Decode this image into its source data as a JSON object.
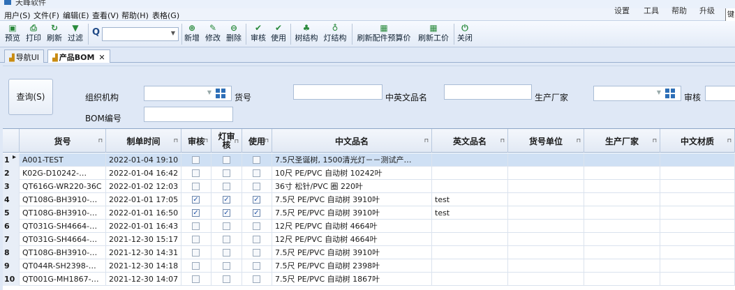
{
  "app": {
    "title": "天峰软件"
  },
  "menu": {
    "items": [
      "用户(S)",
      "文件(F)",
      "编辑(E)",
      "查看(V)",
      "帮助(H)",
      "表格(G)"
    ],
    "right_items": [
      "设置",
      "工具",
      "帮助",
      "升级"
    ],
    "keyboard_tab": "键"
  },
  "toolbar": {
    "buttons": [
      {
        "label": "预览",
        "icon": "preview-icon",
        "glyph": "▣"
      },
      {
        "label": "打印",
        "icon": "print-icon",
        "glyph": "⎙"
      },
      {
        "label": "刷新",
        "icon": "refresh-icon",
        "glyph": "↻"
      },
      {
        "label": "过滤",
        "icon": "filter-icon",
        "glyph": "▼"
      },
      {
        "label": "新增",
        "icon": "add-icon",
        "glyph": "⊕"
      },
      {
        "label": "修改",
        "icon": "edit-icon",
        "glyph": "✎"
      },
      {
        "label": "删除",
        "icon": "delete-icon",
        "glyph": "⊖"
      },
      {
        "label": "审核",
        "icon": "check-icon",
        "glyph": "✔"
      },
      {
        "label": "使用",
        "icon": "use-icon",
        "glyph": "✔"
      },
      {
        "label": "树结构",
        "icon": "tree-icon",
        "glyph": "♣"
      },
      {
        "label": "灯结构",
        "icon": "bulb-icon",
        "glyph": "♁"
      },
      {
        "label": "刷新配件预算价",
        "icon": "calculator-icon",
        "glyph": "▦"
      },
      {
        "label": "刷新工价",
        "icon": "calculator-icon",
        "glyph": "▦"
      },
      {
        "label": "关闭",
        "icon": "power-icon",
        "glyph": "⏻"
      }
    ],
    "search_value": ""
  },
  "tabs": [
    {
      "label": "导航UI",
      "active": false
    },
    {
      "label": "产品BOM",
      "active": true
    }
  ],
  "filter": {
    "query_button": "查询(S)",
    "org_label": "组织机构",
    "item_no_label": "货号",
    "cn_en_name_label": "中英文品名",
    "manufacturer_label": "生产厂家",
    "audit_label": "审核",
    "bom_no_label": "BOM编号",
    "org_value": "",
    "item_no_value": "",
    "cn_en_name_value": "",
    "manufacturer_value": "",
    "bom_no_value": ""
  },
  "grid": {
    "headers": [
      "货号",
      "制单时间",
      "审核",
      "灯审核",
      "使用",
      "中文品名",
      "英文品名",
      "货号单位",
      "生产厂家",
      "中文材质"
    ],
    "rows": [
      {
        "num": "1",
        "item_no": "A001-TEST",
        "time": "2022-01-04 19:10",
        "audit": false,
        "light_audit": false,
        "use": false,
        "cn_name": "7.5尺圣诞树, 1500清光灯－－测试产…",
        "en_name": ""
      },
      {
        "num": "2",
        "item_no": "K02G-D10242-…",
        "time": "2022-01-04 16:42",
        "audit": false,
        "light_audit": false,
        "use": false,
        "cn_name": "10尺 PE/PVC 自动树 10242叶",
        "en_name": ""
      },
      {
        "num": "3",
        "item_no": "QT616G-WR220-36C",
        "time": "2022-01-02 12:03",
        "audit": false,
        "light_audit": false,
        "use": false,
        "cn_name": "36寸 松针/PVC 圈 220叶",
        "en_name": ""
      },
      {
        "num": "4",
        "item_no": "QT108G-BH3910-…",
        "time": "2022-01-01 17:05",
        "audit": true,
        "light_audit": true,
        "use": true,
        "cn_name": "7.5尺 PE/PVC 自动树 3910叶",
        "en_name": "test"
      },
      {
        "num": "5",
        "item_no": "QT108G-BH3910-…",
        "time": "2022-01-01 16:50",
        "audit": true,
        "light_audit": true,
        "use": true,
        "cn_name": "7.5尺 PE/PVC 自动树 3910叶",
        "en_name": "test"
      },
      {
        "num": "6",
        "item_no": "QT031G-SH4664-…",
        "time": "2022-01-01 16:43",
        "audit": false,
        "light_audit": false,
        "use": false,
        "cn_name": "12尺 PE/PVC 自动树 4664叶",
        "en_name": ""
      },
      {
        "num": "7",
        "item_no": "QT031G-SH4664-…",
        "time": "2021-12-30 15:17",
        "audit": false,
        "light_audit": false,
        "use": false,
        "cn_name": "12尺 PE/PVC 自动树 4664叶",
        "en_name": ""
      },
      {
        "num": "8",
        "item_no": "QT108G-BH3910-…",
        "time": "2021-12-30 14:31",
        "audit": false,
        "light_audit": false,
        "use": false,
        "cn_name": "7.5尺 PE/PVC 自动树 3910叶",
        "en_name": ""
      },
      {
        "num": "9",
        "item_no": "QT044R-SH2398-…",
        "time": "2021-12-30 14:18",
        "audit": false,
        "light_audit": false,
        "use": false,
        "cn_name": "7.5尺 PE/PVC 自动树 2398叶",
        "en_name": ""
      },
      {
        "num": "10",
        "item_no": "QT001G-MH1867-…",
        "time": "2021-12-30 14:07",
        "audit": false,
        "light_audit": false,
        "use": false,
        "cn_name": "7.5尺 PE/PVC 自动树 1867叶",
        "en_name": ""
      }
    ]
  }
}
